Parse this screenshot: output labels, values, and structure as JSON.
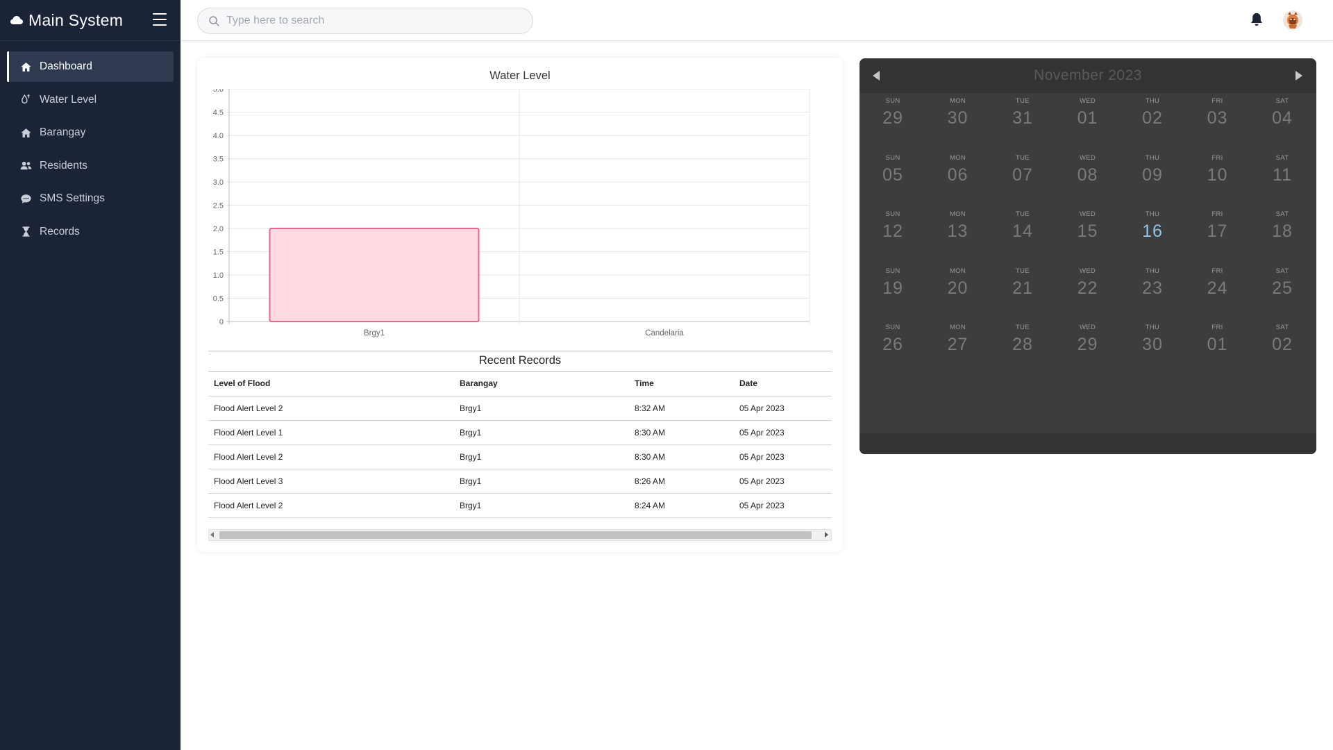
{
  "brand": {
    "title": "Main System",
    "icon": "cloud-icon"
  },
  "sidebar": {
    "items": [
      {
        "label": "Dashboard",
        "icon": "home-icon",
        "active": true
      },
      {
        "label": "Water Level",
        "icon": "water-drop-icon",
        "active": false
      },
      {
        "label": "Barangay",
        "icon": "home-icon",
        "active": false
      },
      {
        "label": "Residents",
        "icon": "users-icon",
        "active": false
      },
      {
        "label": "SMS Settings",
        "icon": "chat-bubble-icon",
        "active": false
      },
      {
        "label": "Records",
        "icon": "hourglass-icon",
        "active": false
      }
    ]
  },
  "header": {
    "search_placeholder": "Type here to search",
    "icons": [
      "search-icon",
      "bell-icon",
      "avatar"
    ]
  },
  "chart_data": {
    "type": "bar",
    "title": "Water Level",
    "categories": [
      "Brgy1",
      "Candelaria"
    ],
    "values": [
      2,
      null
    ],
    "ylim": [
      0,
      5
    ],
    "yticks": [
      "0",
      "0.5",
      "1.0",
      "1.5",
      "2.0",
      "2.5",
      "3.0",
      "3.5",
      "4.0",
      "4.5",
      "5.0"
    ],
    "grid": true,
    "bar_fill": "#ffdce3",
    "bar_stroke": "#f0648a"
  },
  "records": {
    "title": "Recent Records",
    "columns": [
      "Level of Flood",
      "Barangay",
      "Time",
      "Date"
    ],
    "rows": [
      [
        "Flood Alert Level 2",
        "Brgy1",
        "8:32 AM",
        "05 Apr 2023"
      ],
      [
        "Flood Alert Level 1",
        "Brgy1",
        "8:30 AM",
        "05 Apr 2023"
      ],
      [
        "Flood Alert Level 2",
        "Brgy1",
        "8:30 AM",
        "05 Apr 2023"
      ],
      [
        "Flood Alert Level 3",
        "Brgy1",
        "8:26 AM",
        "05 Apr 2023"
      ],
      [
        "Flood Alert Level 2",
        "Brgy1",
        "8:24 AM",
        "05 Apr 2023"
      ]
    ]
  },
  "calendar": {
    "title": "November 2023",
    "today": "16",
    "weekdays": [
      "SUN",
      "MON",
      "TUE",
      "WED",
      "THU",
      "FRI",
      "SAT"
    ],
    "weeks": [
      [
        "29",
        "30",
        "31",
        "01",
        "02",
        "03",
        "04"
      ],
      [
        "05",
        "06",
        "07",
        "08",
        "09",
        "10",
        "11"
      ],
      [
        "12",
        "13",
        "14",
        "15",
        "16",
        "17",
        "18"
      ],
      [
        "19",
        "20",
        "21",
        "22",
        "23",
        "24",
        "25"
      ],
      [
        "26",
        "27",
        "28",
        "29",
        "30",
        "01",
        "02"
      ]
    ],
    "today_color": "#8fc3ea"
  }
}
